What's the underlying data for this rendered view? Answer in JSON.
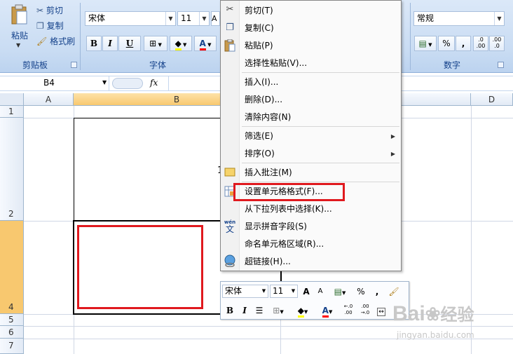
{
  "ribbon": {
    "clipboard": {
      "paste_label": "粘贴",
      "cut_label": "剪切",
      "copy_label": "复制",
      "format_painter_label": "格式刷",
      "group_label": "剪贴板"
    },
    "font": {
      "font_name": "宋体",
      "font_size": "11",
      "bold": "B",
      "italic": "I",
      "underline": "U",
      "font_color_glyph": "A",
      "group_label": "字体"
    },
    "number": {
      "format_value": "常规",
      "percent": "%",
      "comma": ",",
      "inc_decimal": ".0 .00",
      "dec_decimal": ".00 .0",
      "group_label": "数字"
    }
  },
  "formula_bar": {
    "name_box": "B4",
    "fx_label": "fx"
  },
  "sheet": {
    "columns": [
      "A",
      "B",
      "D"
    ],
    "rows": [
      "1",
      "2",
      "4",
      "5",
      "6",
      "7"
    ],
    "cell_fragment": "1"
  },
  "context_menu": {
    "items": [
      {
        "label": "剪切(T)",
        "icon": "scissors-icon"
      },
      {
        "label": "复制(C)",
        "icon": "copy-icon"
      },
      {
        "label": "粘贴(P)",
        "icon": "paste-icon"
      },
      {
        "label": "选择性粘贴(V)..."
      },
      {
        "label": "插入(I)..."
      },
      {
        "label": "删除(D)..."
      },
      {
        "label": "清除内容(N)"
      },
      {
        "label": "筛选(E)",
        "submenu": true
      },
      {
        "label": "排序(O)",
        "submenu": true
      },
      {
        "label": "插入批注(M)",
        "icon": "comment-icon"
      },
      {
        "label": "设置单元格格式(F)...",
        "icon": "format-cells-icon"
      },
      {
        "label": "从下拉列表中选择(K)..."
      },
      {
        "label": "显示拼音字段(S)",
        "icon": "phonetic-icon"
      },
      {
        "label": "命名单元格区域(R)..."
      },
      {
        "label": "超链接(H)...",
        "icon": "hyperlink-icon"
      }
    ],
    "phonetic_glyph_top": "wén",
    "phonetic_glyph_bottom": "文"
  },
  "mini_toolbar": {
    "font_name": "宋体",
    "font_size": "11",
    "bold": "B",
    "italic": "I",
    "percent": "%",
    "comma": ",",
    "font_color_glyph": "A",
    "grow_font": "A",
    "shrink_font": "A"
  },
  "colors": {
    "highlight_red": "#e0191e",
    "ribbon_label": "#15428b",
    "selected_header": "#f8c86f"
  },
  "watermark": {
    "brand": "Bai",
    "brand_cn": "经验",
    "url": "jingyan.baidu.com"
  }
}
